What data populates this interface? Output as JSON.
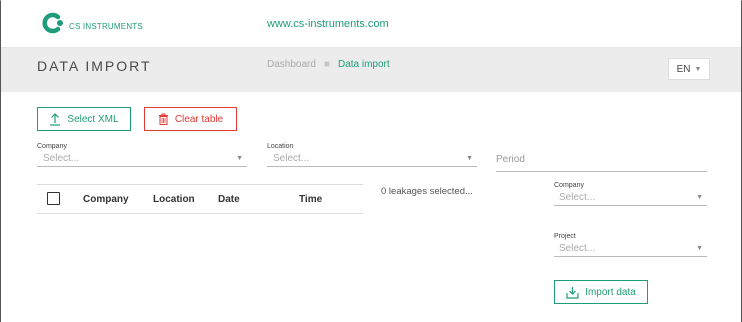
{
  "brand": {
    "logo_text": "CS INSTRUMENTS",
    "website": "www.cs-instruments.com",
    "accent_color": "#1f9c7a"
  },
  "header": {
    "title": "DATA IMPORT",
    "breadcrumb": [
      "Dashboard",
      "Data import"
    ],
    "language": "EN"
  },
  "toolbar": {
    "select_xml_label": "Select XML",
    "clear_table_label": "Clear table"
  },
  "filters": {
    "company": {
      "label": "Company",
      "placeholder": "Select..."
    },
    "location": {
      "label": "Location",
      "placeholder": "Select..."
    },
    "period": {
      "placeholder": "Period"
    }
  },
  "table": {
    "columns": [
      "Company",
      "Location",
      "Date",
      "Time"
    ]
  },
  "selection_status": "0 leakages selected...",
  "import_panel": {
    "company": {
      "label": "Company",
      "placeholder": "Select..."
    },
    "project": {
      "label": "Project",
      "placeholder": "Select..."
    },
    "import_label": "Import data"
  },
  "icons": {
    "upload": "upload-icon",
    "trash": "trash-icon",
    "import": "import-icon",
    "caret": "chevron-down-icon"
  },
  "colors": {
    "danger": "#e53935",
    "header_bg": "#ececec"
  }
}
